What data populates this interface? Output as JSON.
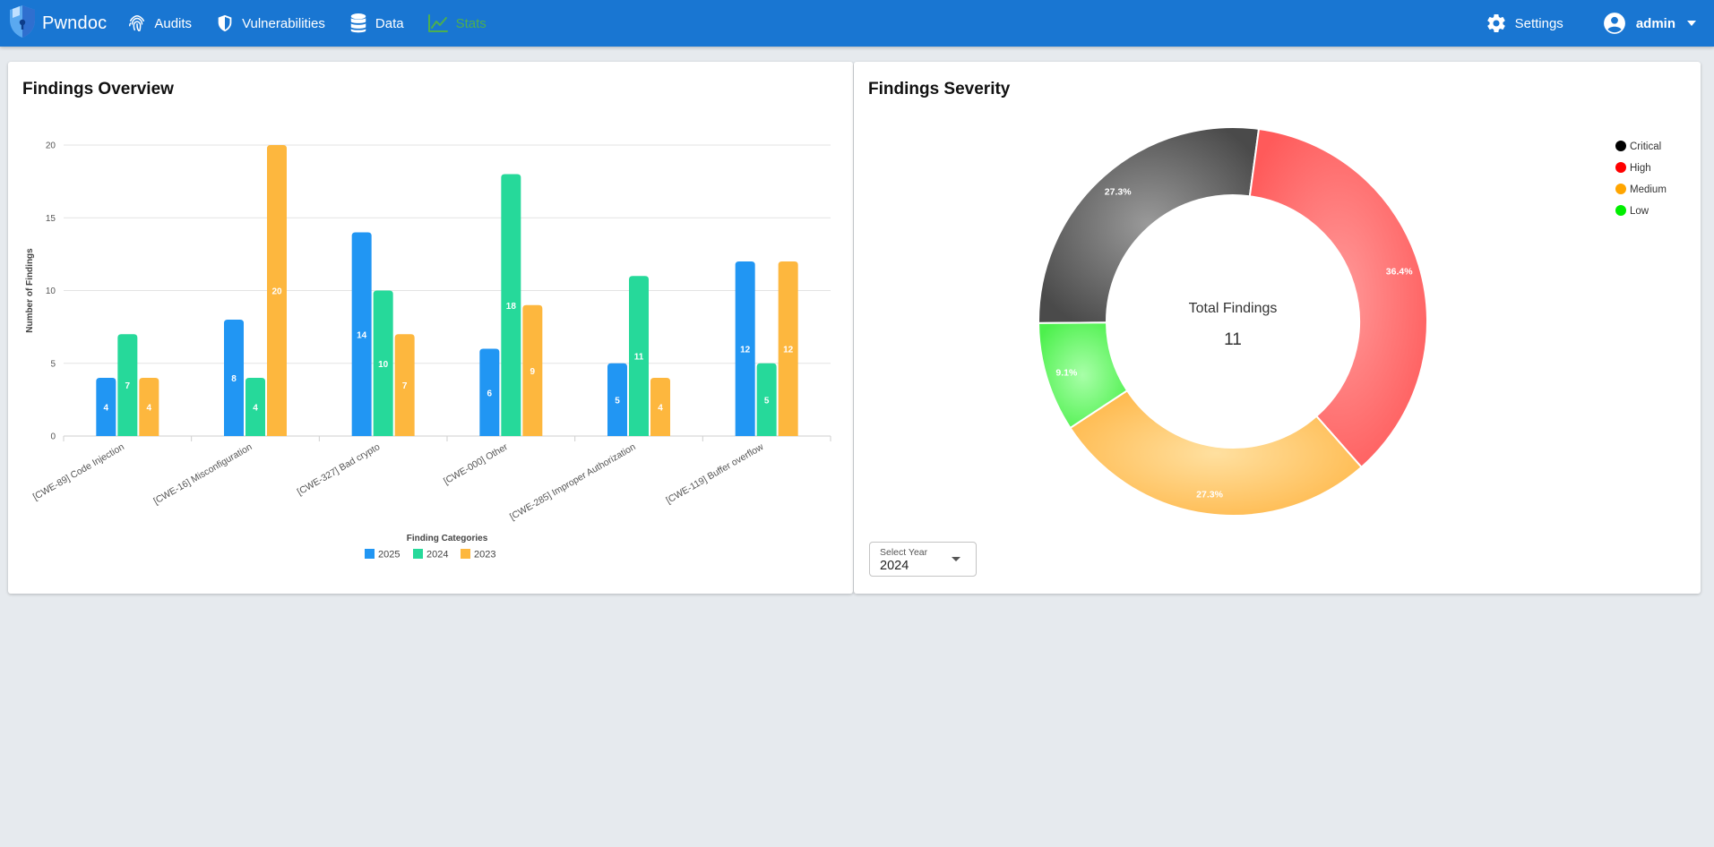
{
  "app": {
    "name": "Pwndoc",
    "nav": [
      {
        "label": "Audits",
        "icon": "fingerprint-icon"
      },
      {
        "label": "Vulnerabilities",
        "icon": "shield-icon"
      },
      {
        "label": "Data",
        "icon": "database-icon"
      },
      {
        "label": "Stats",
        "icon": "chart-line-icon",
        "active": true
      }
    ],
    "settings_label": "Settings",
    "user_label": "admin"
  },
  "overview": {
    "title": "Findings Overview",
    "chart_data": {
      "type": "bar",
      "categories": [
        "[CWE-89] Code Injection",
        "[CWE-16] Misconfiguration",
        "[CWE-327] Bad crypto",
        "[CWE-000] Other",
        "[CWE-285] Improper Authorization",
        "[CWE-119] Buffer overflow"
      ],
      "series": [
        {
          "name": "2025",
          "color": "#2196f3",
          "values": [
            4,
            8,
            14,
            6,
            5,
            12
          ]
        },
        {
          "name": "2024",
          "color": "#26d99a",
          "values": [
            7,
            4,
            10,
            18,
            11,
            5
          ]
        },
        {
          "name": "2023",
          "color": "#fdb73e",
          "values": [
            4,
            20,
            7,
            9,
            4,
            12
          ]
        }
      ],
      "xlabel": "Finding Categories",
      "ylabel": "Number of Findings",
      "ylim": [
        0,
        20
      ],
      "yticks": [
        0,
        5,
        10,
        15,
        20
      ],
      "grid": true,
      "legend": "bottom"
    }
  },
  "severity": {
    "title": "Findings Severity",
    "chart_data": {
      "type": "pie",
      "donut": true,
      "center_title": "Total Findings",
      "center_value": "11",
      "legend": "top-right",
      "slices": [
        {
          "name": "Critical",
          "legend_color": "#000000",
          "fill": "#6e6e6e",
          "value": 27.3,
          "label": "27.3%"
        },
        {
          "name": "High",
          "legend_color": "#ff0000",
          "fill": "#ff7575",
          "value": 36.4,
          "label": "36.4%"
        },
        {
          "name": "Medium",
          "legend_color": "#ffa500",
          "fill": "#ffc966",
          "value": 27.3,
          "label": "27.3%"
        },
        {
          "name": "Low",
          "legend_color": "#00ee00",
          "fill": "#75f575",
          "value": 9.1,
          "label": "9.1%"
        }
      ]
    },
    "year_select": {
      "label": "Select Year",
      "value": "2024"
    }
  }
}
